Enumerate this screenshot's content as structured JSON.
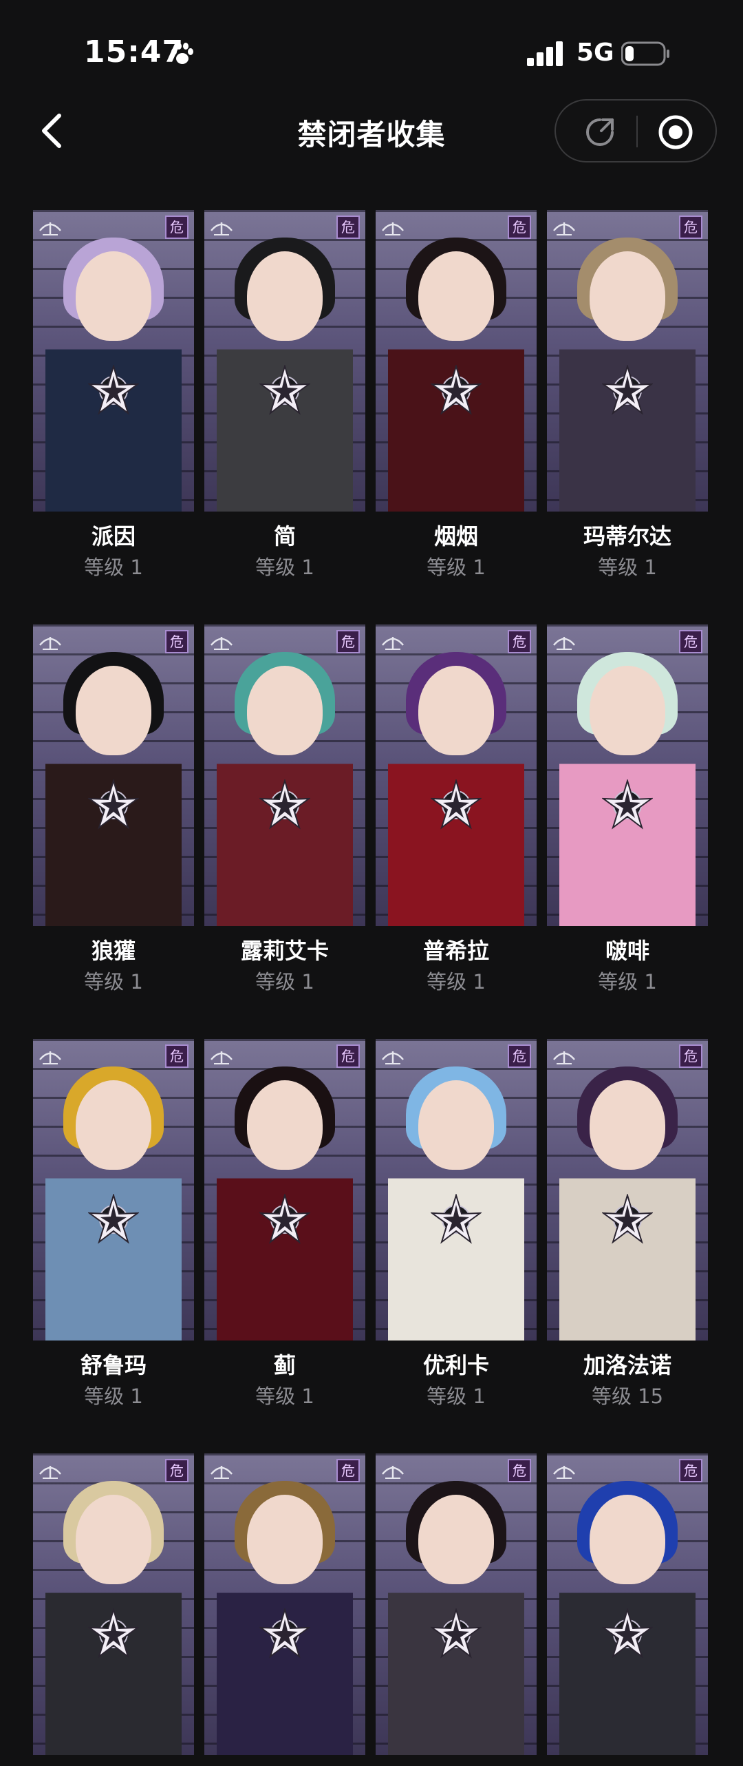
{
  "status": {
    "time": "15:47",
    "network": "5G"
  },
  "nav": {
    "title": "禁闭者收集"
  },
  "level_prefix": "等级",
  "characters": [
    {
      "name": "派因",
      "level": "等级 1",
      "hair": "#b9a4d6",
      "outfit": "#1f2a44"
    },
    {
      "name": "简",
      "level": "等级 1",
      "hair": "#1a1a1c",
      "outfit": "#3c3c40"
    },
    {
      "name": "烟烟",
      "level": "等级 1",
      "hair": "#1c1416",
      "outfit": "#4a1218"
    },
    {
      "name": "玛蒂尔达",
      "level": "等级 1",
      "hair": "#a48d6c",
      "outfit": "#3a3346"
    },
    {
      "name": "狼獾",
      "level": "等级 1",
      "hair": "#121214",
      "outfit": "#2a1a1a"
    },
    {
      "name": "露莉艾卡",
      "level": "等级 1",
      "hair": "#4aa39a",
      "outfit": "#6b1c26"
    },
    {
      "name": "普希拉",
      "level": "等级 1",
      "hair": "#5a2e7a",
      "outfit": "#8a1420"
    },
    {
      "name": "啵啡",
      "level": "等级 1",
      "hair": "#cfe7dc",
      "outfit": "#e79ac2"
    },
    {
      "name": "舒鲁玛",
      "level": "等级 1",
      "hair": "#d9a82a",
      "outfit": "#6e8fb4"
    },
    {
      "name": "蓟",
      "level": "等级 1",
      "hair": "#1a1012",
      "outfit": "#5a0f1a"
    },
    {
      "name": "优利卡",
      "level": "等级 1",
      "hair": "#7fb6e4",
      "outfit": "#e8e4dc"
    },
    {
      "name": "加洛法诺",
      "level": "等级 15",
      "hair": "#3a2348",
      "outfit": "#d8cfc4"
    },
    {
      "name": "",
      "level": "",
      "hair": "#d9c9a0",
      "outfit": "#2a2a30"
    },
    {
      "name": "",
      "level": "",
      "hair": "#8a6a3a",
      "outfit": "#2a2244"
    },
    {
      "name": "",
      "level": "",
      "hair": "#1c1418",
      "outfit": "#3a3540"
    },
    {
      "name": "",
      "level": "",
      "hair": "#1f3fae",
      "outfit": "#2b2b33"
    }
  ],
  "icons": {
    "back": "chevron-left-icon",
    "share": "share-icon",
    "target": "target-icon",
    "paw": "paw-icon",
    "signal": "signal-icon",
    "battery": "battery-icon",
    "rank": "star-badge-icon",
    "danger": "danger-tag-icon",
    "weapon": "weapon-class-icon"
  },
  "danger_tag_glyph": "危"
}
